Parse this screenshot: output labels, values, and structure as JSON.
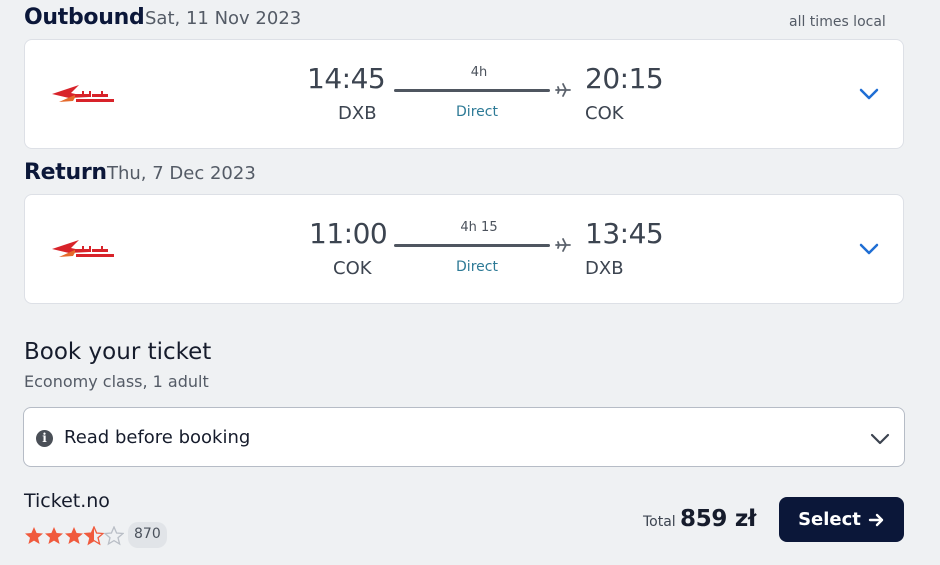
{
  "outbound": {
    "title": "Outbound",
    "date": "Sat, 11 Nov 2023",
    "note": "all times local",
    "depart_time": "14:45",
    "depart_code": "DXB",
    "duration": "4h",
    "stops": "Direct",
    "arrive_time": "20:15",
    "arrive_code": "COK"
  },
  "return": {
    "title": "Return",
    "date": "Thu, 7 Dec 2023",
    "depart_time": "11:00",
    "depart_code": "COK",
    "duration": "4h 15",
    "stops": "Direct",
    "arrive_time": "13:45",
    "arrive_code": "DXB"
  },
  "booking": {
    "title": "Book your ticket",
    "subtitle": "Economy class, 1 adult",
    "read_before": "Read before booking",
    "vendor": "Ticket.no",
    "rating": 3.5,
    "rating_max": 5,
    "review_count": "870",
    "total_label": "Total",
    "total_value": "859 zł",
    "select_label": "Select"
  },
  "colors": {
    "airline_red": "#d8232a",
    "accent_blue": "#2d7a96",
    "chevron_blue": "#1f6ed4",
    "star_orange": "#f05a3d",
    "button_bg": "#0b1739"
  },
  "icons": {
    "airline_logo": "air-india-logo",
    "plane": "plane-icon",
    "expand": "chevron-down-icon",
    "info": "info-icon",
    "arrow": "arrow-right-icon"
  }
}
